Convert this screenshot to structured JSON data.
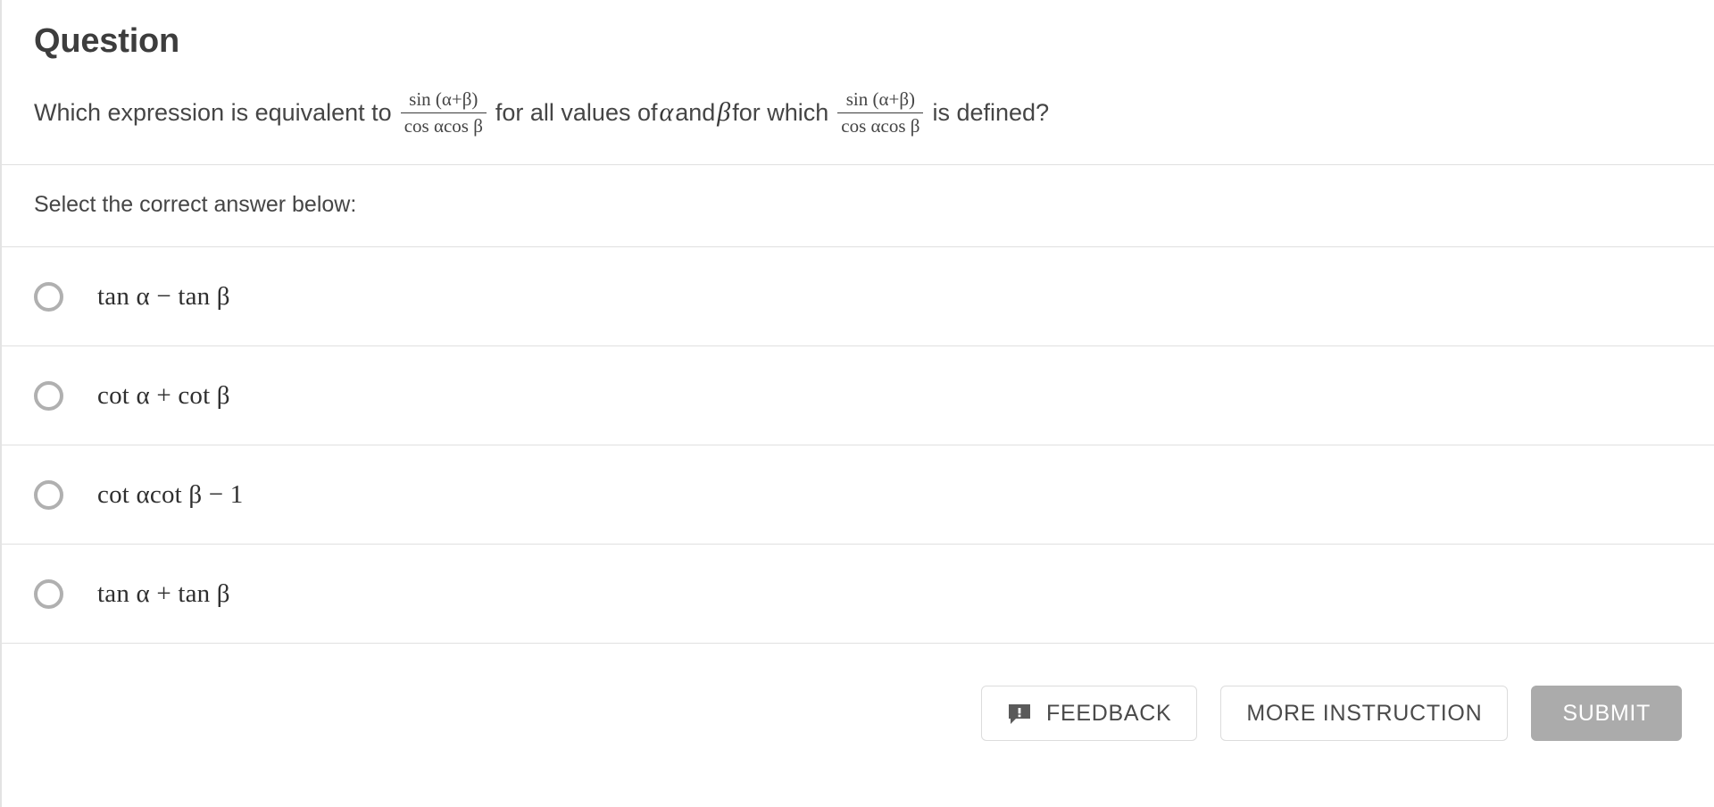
{
  "question": {
    "title": "Question",
    "text_part_1": "Which expression is equivalent to",
    "expression_1": {
      "numerator": "sin (α+β)",
      "denominator": "cos αcos β"
    },
    "text_part_2": "for all values of",
    "variable_1": "α",
    "text_part_3": "and",
    "variable_2": "β",
    "text_part_4": "for which",
    "expression_2": {
      "numerator": "sin (α+β)",
      "denominator": "cos αcos β"
    },
    "text_part_5": "is defined?"
  },
  "prompt": "Select the correct answer below:",
  "options": [
    {
      "id": "option-a",
      "label": "tan α − tan β",
      "selected": false
    },
    {
      "id": "option-b",
      "label": "cot α + cot β",
      "selected": false
    },
    {
      "id": "option-c",
      "label": "cot αcot β − 1",
      "selected": false
    },
    {
      "id": "option-d",
      "label": "tan α + tan β",
      "selected": false
    }
  ],
  "footer": {
    "feedback_label": "FEEDBACK",
    "more_instruction_label": "MORE INSTRUCTION",
    "submit_label": "SUBMIT",
    "feedback_icon": "speech-bubble-alert-icon"
  },
  "colors": {
    "border": "#e0e0e0",
    "radio_ring": "#b0b0b0",
    "submit_disabled_bg": "#ababab",
    "text": "#454545",
    "title": "#3d3d3d"
  }
}
